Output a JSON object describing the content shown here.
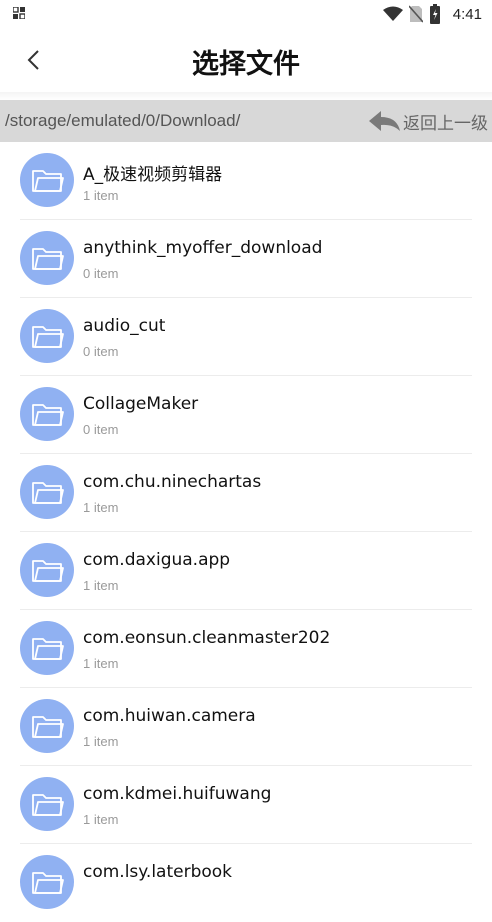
{
  "status_bar": {
    "time": "4:41",
    "left_icon": "app-notification-icon",
    "right_icons": [
      "wifi-icon",
      "no-sim-icon",
      "battery-icon"
    ]
  },
  "header": {
    "title": "选择文件",
    "back_icon": "chevron-left-icon"
  },
  "path_bar": {
    "path": "/storage/emulated/0/Download/",
    "up_level_label": "返回上一级",
    "up_level_icon": "reply-arrow-icon"
  },
  "colors": {
    "folder_icon": "#90b1f2",
    "path_bar_bg": "#d8d8d8"
  },
  "files": [
    {
      "name": "A_极速视频剪辑器",
      "count": "1 item"
    },
    {
      "name": "anythink_myoffer_download",
      "count": "0 item"
    },
    {
      "name": "audio_cut",
      "count": "0 item"
    },
    {
      "name": "CollageMaker",
      "count": "0 item"
    },
    {
      "name": "com.chu.ninechartas",
      "count": "1 item"
    },
    {
      "name": "com.daxigua.app",
      "count": "1 item"
    },
    {
      "name": "com.eonsun.cleanmaster202",
      "count": "1 item"
    },
    {
      "name": "com.huiwan.camera",
      "count": "1 item"
    },
    {
      "name": "com.kdmei.huifuwang",
      "count": "1 item"
    },
    {
      "name": "com.lsy.laterbook",
      "count": ""
    }
  ]
}
